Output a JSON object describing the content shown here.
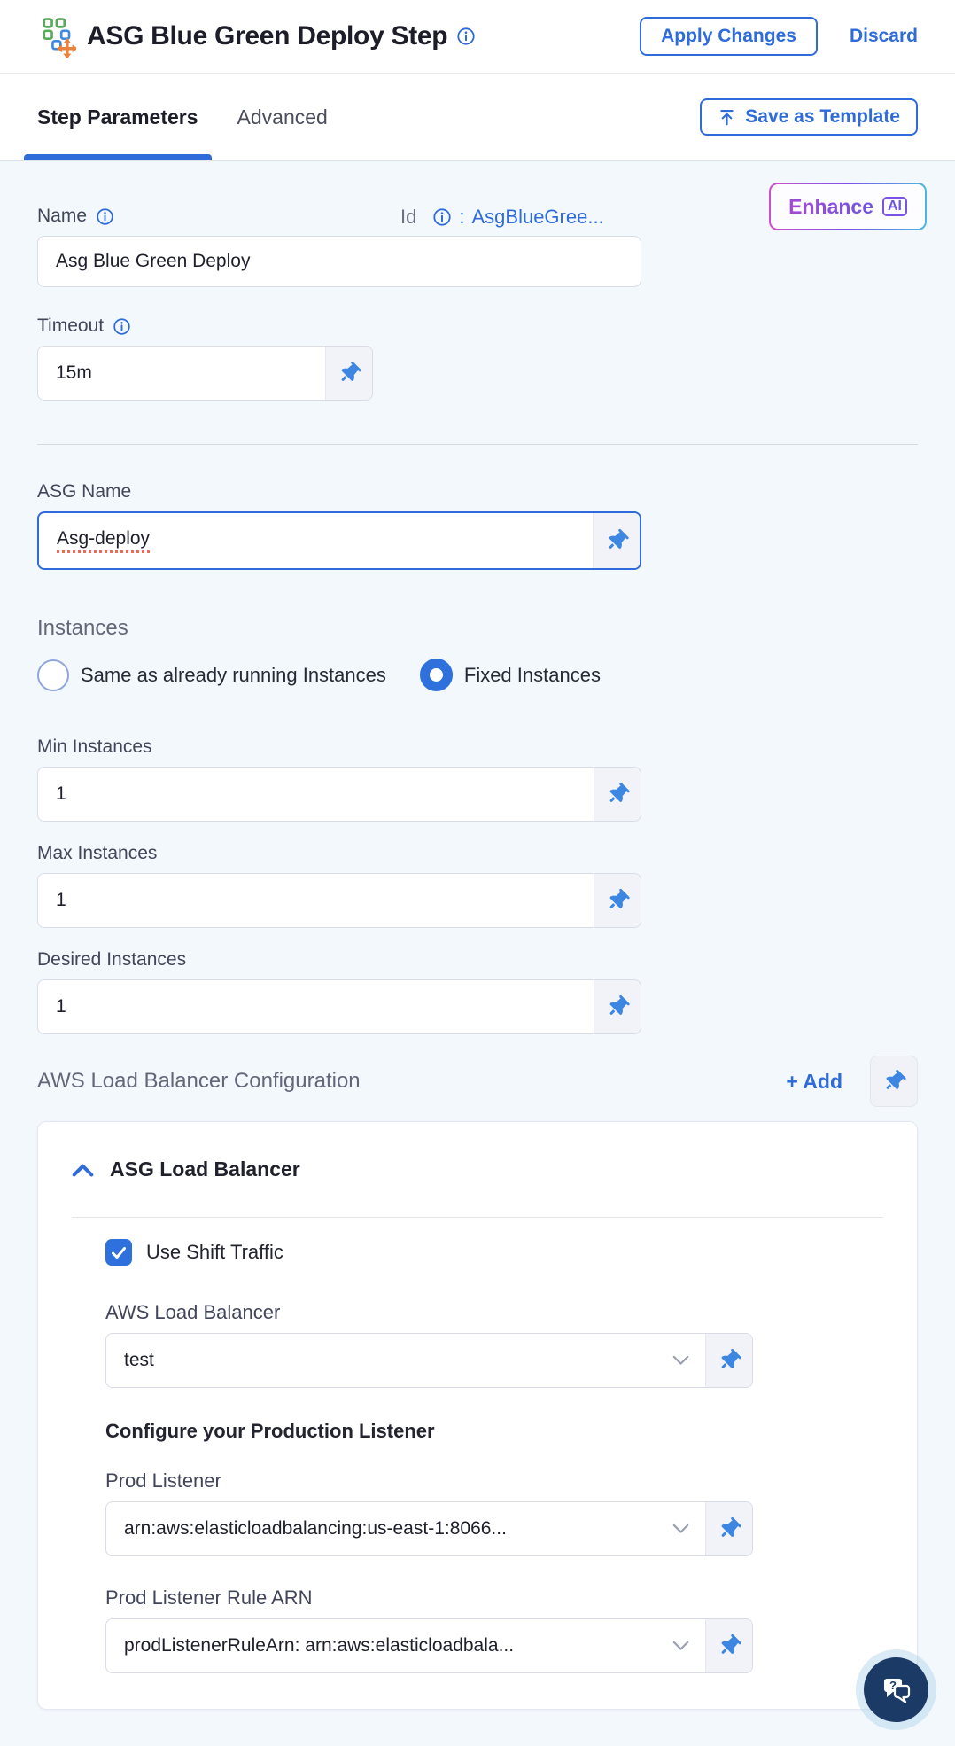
{
  "header": {
    "title": "ASG Blue Green Deploy Step",
    "apply_label": "Apply Changes",
    "discard_label": "Discard"
  },
  "tabs": {
    "step_parameters": "Step Parameters",
    "advanced": "Advanced",
    "save_as_template": "Save as Template"
  },
  "form": {
    "name": {
      "label": "Name",
      "value": "Asg Blue Green Deploy"
    },
    "id": {
      "label": "Id",
      "separator": ":",
      "value": "AsgBlueGree..."
    },
    "enhance": {
      "label": "Enhance",
      "badge": "AI"
    },
    "timeout": {
      "label": "Timeout",
      "value": "15m"
    },
    "asg_name": {
      "label": "ASG Name",
      "value": "Asg-deploy"
    },
    "instances": {
      "heading": "Instances",
      "options": [
        {
          "label": "Same as already running Instances",
          "selected": false
        },
        {
          "label": "Fixed Instances",
          "selected": true
        }
      ],
      "min": {
        "label": "Min Instances",
        "value": "1"
      },
      "max": {
        "label": "Max Instances",
        "value": "1"
      },
      "desired": {
        "label": "Desired Instances",
        "value": "1"
      }
    },
    "lb_config": {
      "heading": "AWS Load Balancer Configuration",
      "add_label": "+ Add",
      "card": {
        "accordion_title": "ASG Load Balancer",
        "use_shift_traffic": {
          "label": "Use Shift Traffic",
          "checked": true
        },
        "aws_load_balancer": {
          "label": "AWS Load Balancer",
          "value": "test"
        },
        "prod_heading": "Configure your Production Listener",
        "prod_listener": {
          "label": "Prod Listener",
          "value": "arn:aws:elasticloadbalancing:us-east-1:8066..."
        },
        "prod_listener_rule": {
          "label": "Prod Listener Rule ARN",
          "value": "prodListenerRuleArn: arn:aws:elasticloadbala..."
        }
      }
    }
  },
  "icons": {
    "module": "asg-blue-green-module-icon",
    "info": "info-icon",
    "pin": "pin-icon",
    "upload": "upload-icon",
    "chevron_up": "chevron-up-icon",
    "chevron_down": "chevron-down-icon",
    "check": "check-icon",
    "chat": "chat-question-icon"
  },
  "colors": {
    "primary_blue": "#2f6bd9",
    "pin_blue": "#3d87e2",
    "checkbox_blue": "#2e71dd",
    "content_bg": "#f3f8fd",
    "card_bg": "#ffffff",
    "chat_fab": "#1b3a66",
    "squiggle_red": "#ef6a55",
    "enhance_gradient": [
      "#cd4fc9",
      "#7b52e6",
      "#48b9e2"
    ],
    "icon_green": "#57ab5c",
    "icon_blue": "#4089e2",
    "icon_orange": "#e8823d"
  }
}
